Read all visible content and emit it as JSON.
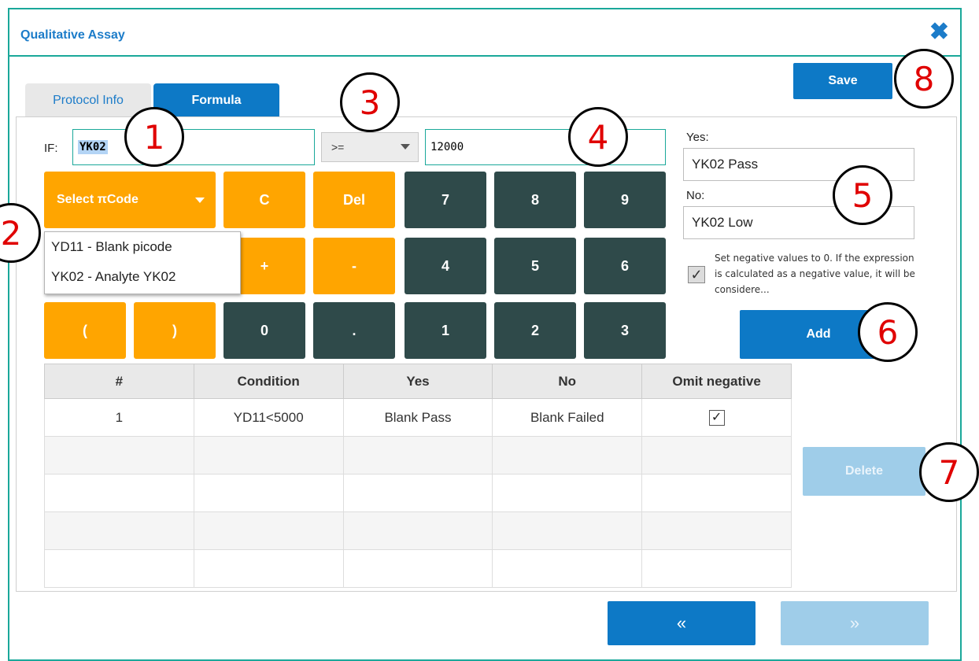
{
  "dialog": {
    "title": "Qualitative Assay",
    "close_icon": "close-icon"
  },
  "toolbar": {
    "save_label": "Save"
  },
  "tabs": [
    {
      "label": "Protocol Info",
      "active": false
    },
    {
      "label": "Formula",
      "active": true
    }
  ],
  "formula": {
    "if_label": "IF:",
    "if_value": "YK02",
    "operator": ">=",
    "value": "12000"
  },
  "result": {
    "yes_label": "Yes:",
    "yes_value": "YK02 Pass",
    "no_label": "No:",
    "no_value": "YK02 Low",
    "omit_negative_checked": true,
    "omit_negative_text": "Set negative values to 0. If the expression is calculated as a negative value, it will be considere...",
    "add_label": "Add"
  },
  "keypad": {
    "select_picode": "Select πCode",
    "clear": "C",
    "del": "Del",
    "plus": "+",
    "minus": "-",
    "lparen": "(",
    "rparen": ")",
    "zero": "0",
    "dot": ".",
    "one": "1",
    "two": "2",
    "three": "3",
    "four": "4",
    "five": "5",
    "six": "6",
    "seven": "7",
    "eight": "8",
    "nine": "9"
  },
  "picode_dropdown": [
    "YD11 - Blank picode",
    "YK02 - Analyte YK02"
  ],
  "table": {
    "headers": [
      "#",
      "Condition",
      "Yes",
      "No",
      "Omit negative"
    ],
    "rows": [
      {
        "num": "1",
        "condition": "YD11<5000",
        "yes": "Blank Pass",
        "no": "Blank Failed",
        "omit_negative": true
      }
    ]
  },
  "delete_label": "Delete",
  "nav": {
    "prev": "«",
    "next": "»"
  },
  "callouts": [
    "1",
    "2",
    "3",
    "4",
    "5",
    "6",
    "7",
    "8"
  ],
  "colors": {
    "accent": "#0d79c6",
    "keypad_orange": "#ffa500",
    "keypad_dark": "#2f4a4a",
    "border_teal": "#1aa89a",
    "callout_red": "#e00000"
  }
}
